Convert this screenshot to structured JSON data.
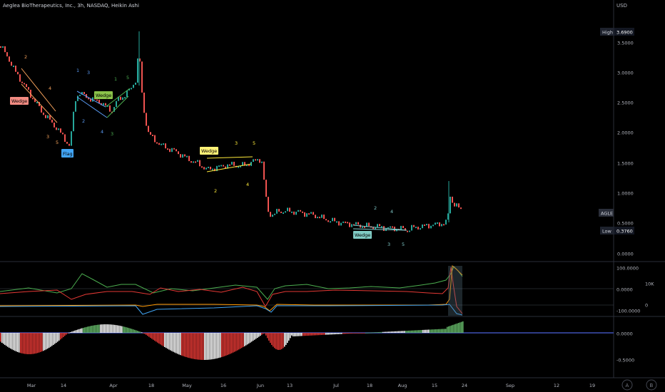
{
  "header": {
    "title": "Aeglea BioTherapeutics, Inc., 3h, NASDAQ, Heikin Ashi",
    "currency": "USD"
  },
  "price_axis": {
    "ticks": [
      "3.5000",
      "3.0000",
      "2.5000",
      "2.0000",
      "1.5000",
      "1.0000",
      "0.5000",
      "0.0000"
    ],
    "high_tag": "High",
    "high_value": "3.6900",
    "low_tag": "Low",
    "low_value": "0.3760",
    "symbol_badge": "AGLE"
  },
  "indicator1_axis": {
    "ticks": [
      "100.0000",
      "0.0000",
      "-100.0000"
    ],
    "volume_ticks": [
      "10K",
      "0"
    ]
  },
  "indicator2_axis": {
    "ticks": [
      "0.0000",
      "-0.5000"
    ]
  },
  "time_axis": {
    "ticks": [
      "Mar",
      "14",
      "Apr",
      "18",
      "May",
      "16",
      "Jun",
      "13",
      "Jul",
      "18",
      "Aug",
      "15",
      "24",
      "Sep",
      "12",
      "19"
    ]
  },
  "footer_buttons": {
    "auto": "A",
    "settings": "B"
  },
  "annotations": {
    "wedge_labels": [
      "Wedge",
      "Wedge",
      "Wedge",
      "Wedge"
    ],
    "flag_label": "Flag",
    "wave_numbers": [
      "2",
      "4",
      "3",
      "5",
      "1",
      "3",
      "2",
      "4",
      "1",
      "3",
      "5",
      "2",
      "4",
      "3",
      "5",
      "2",
      "4",
      "3",
      "5"
    ]
  },
  "colors": {
    "up": "#26a69a",
    "down": "#ef5350",
    "bg": "#000000",
    "axis_text": "#b2b5be",
    "orange_label": "#f7a35c",
    "blue_label": "#5b9cf6",
    "green_label": "#4caf50",
    "yellow_label": "#ffeb3b",
    "teal_label": "#7fc8c8"
  }
}
